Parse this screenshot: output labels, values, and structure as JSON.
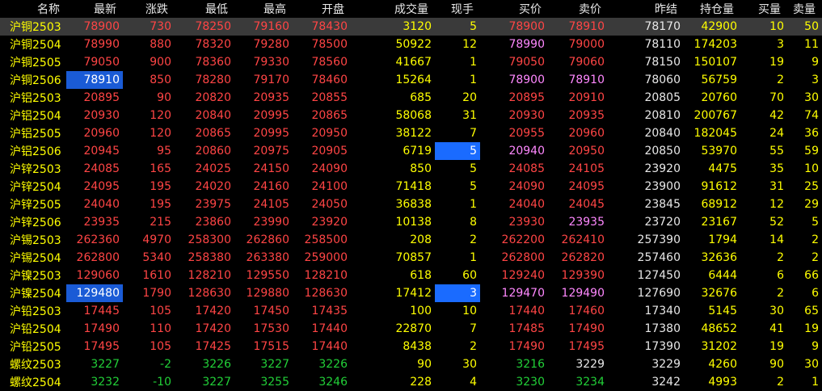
{
  "columns": [
    "名称",
    "最新",
    "涨跌",
    "最低",
    "最高",
    "开盘",
    "成交量",
    "现手",
    "买价",
    "卖价",
    "昨结",
    "持仓量",
    "买量",
    "卖量"
  ],
  "rows": [
    {
      "name": "沪铜2503",
      "last": "78900",
      "chg": "730",
      "low": "78250",
      "high": "79160",
      "open": "78430",
      "vol": "3120",
      "cur": "5",
      "bid": "78900",
      "ask": "78910",
      "prev": "78170",
      "oi": "42900",
      "bv": "10",
      "av": "50",
      "dir": "up",
      "bidc": "up",
      "askc": "up"
    },
    {
      "name": "沪铜2504",
      "last": "78990",
      "chg": "880",
      "low": "78320",
      "high": "79280",
      "open": "78500",
      "vol": "50922",
      "cur": "12",
      "bid": "78990",
      "ask": "79000",
      "prev": "78110",
      "oi": "174203",
      "bv": "3",
      "av": "11",
      "dir": "up",
      "bidc": "mag",
      "askc": "up"
    },
    {
      "name": "沪铜2505",
      "last": "79050",
      "chg": "900",
      "low": "78360",
      "high": "79330",
      "open": "78560",
      "vol": "41667",
      "cur": "1",
      "bid": "79050",
      "ask": "79060",
      "prev": "78150",
      "oi": "150107",
      "bv": "19",
      "av": "9",
      "dir": "up",
      "bidc": "up",
      "askc": "up"
    },
    {
      "name": "沪铜2506",
      "last": "78910",
      "chg": "850",
      "low": "78280",
      "high": "79170",
      "open": "78460",
      "vol": "15264",
      "cur": "1",
      "bid": "78900",
      "ask": "78910",
      "prev": "78060",
      "oi": "56759",
      "bv": "2",
      "av": "3",
      "dir": "up",
      "bidc": "mag",
      "askc": "mag"
    },
    {
      "name": "沪铝2503",
      "last": "20895",
      "chg": "90",
      "low": "20820",
      "high": "20935",
      "open": "20855",
      "vol": "685",
      "cur": "20",
      "bid": "20895",
      "ask": "20910",
      "prev": "20805",
      "oi": "20760",
      "bv": "70",
      "av": "30",
      "dir": "up",
      "bidc": "up",
      "askc": "up"
    },
    {
      "name": "沪铝2504",
      "last": "20930",
      "chg": "120",
      "low": "20840",
      "high": "20995",
      "open": "20865",
      "vol": "58068",
      "cur": "31",
      "bid": "20930",
      "ask": "20935",
      "prev": "20810",
      "oi": "200767",
      "bv": "42",
      "av": "74",
      "dir": "up",
      "bidc": "up",
      "askc": "up"
    },
    {
      "name": "沪铝2505",
      "last": "20960",
      "chg": "120",
      "low": "20865",
      "high": "20995",
      "open": "20950",
      "vol": "38122",
      "cur": "7",
      "bid": "20955",
      "ask": "20960",
      "prev": "20840",
      "oi": "182045",
      "bv": "24",
      "av": "36",
      "dir": "up",
      "bidc": "up",
      "askc": "up"
    },
    {
      "name": "沪铝2506",
      "last": "20945",
      "chg": "95",
      "low": "20860",
      "high": "20975",
      "open": "20905",
      "vol": "6719",
      "cur": "5",
      "bid": "20940",
      "ask": "20950",
      "prev": "20850",
      "oi": "53970",
      "bv": "55",
      "av": "59",
      "dir": "up",
      "bidc": "mag",
      "askc": "up"
    },
    {
      "name": "沪锌2503",
      "last": "24085",
      "chg": "165",
      "low": "24025",
      "high": "24150",
      "open": "24090",
      "vol": "850",
      "cur": "5",
      "bid": "24085",
      "ask": "24105",
      "prev": "23920",
      "oi": "4475",
      "bv": "35",
      "av": "10",
      "dir": "up",
      "bidc": "up",
      "askc": "up"
    },
    {
      "name": "沪锌2504",
      "last": "24095",
      "chg": "195",
      "low": "24020",
      "high": "24160",
      "open": "24100",
      "vol": "71418",
      "cur": "5",
      "bid": "24090",
      "ask": "24095",
      "prev": "23900",
      "oi": "91612",
      "bv": "31",
      "av": "25",
      "dir": "up",
      "bidc": "up",
      "askc": "up"
    },
    {
      "name": "沪锌2505",
      "last": "24040",
      "chg": "195",
      "low": "23975",
      "high": "24105",
      "open": "24050",
      "vol": "36838",
      "cur": "1",
      "bid": "24040",
      "ask": "24045",
      "prev": "23845",
      "oi": "68912",
      "bv": "12",
      "av": "29",
      "dir": "up",
      "bidc": "up",
      "askc": "up"
    },
    {
      "name": "沪锌2506",
      "last": "23935",
      "chg": "215",
      "low": "23860",
      "high": "23990",
      "open": "23920",
      "vol": "10138",
      "cur": "8",
      "bid": "23930",
      "ask": "23935",
      "prev": "23720",
      "oi": "23167",
      "bv": "52",
      "av": "5",
      "dir": "up",
      "bidc": "up",
      "askc": "mag"
    },
    {
      "name": "沪锡2503",
      "last": "262360",
      "chg": "4970",
      "low": "258300",
      "high": "262860",
      "open": "258500",
      "vol": "208",
      "cur": "2",
      "bid": "262200",
      "ask": "262410",
      "prev": "257390",
      "oi": "1794",
      "bv": "14",
      "av": "2",
      "dir": "up",
      "bidc": "up",
      "askc": "up"
    },
    {
      "name": "沪锡2504",
      "last": "262800",
      "chg": "5340",
      "low": "258380",
      "high": "263380",
      "open": "259000",
      "vol": "70857",
      "cur": "1",
      "bid": "262800",
      "ask": "262820",
      "prev": "257460",
      "oi": "32636",
      "bv": "2",
      "av": "2",
      "dir": "up",
      "bidc": "up",
      "askc": "up"
    },
    {
      "name": "沪镍2503",
      "last": "129060",
      "chg": "1610",
      "low": "128210",
      "high": "129550",
      "open": "128210",
      "vol": "618",
      "cur": "60",
      "bid": "129240",
      "ask": "129390",
      "prev": "127450",
      "oi": "6444",
      "bv": "6",
      "av": "66",
      "dir": "up",
      "bidc": "up",
      "askc": "up"
    },
    {
      "name": "沪镍2504",
      "last": "129480",
      "chg": "1790",
      "low": "128630",
      "high": "129880",
      "open": "128630",
      "vol": "17412",
      "cur": "3",
      "bid": "129470",
      "ask": "129490",
      "prev": "127690",
      "oi": "32676",
      "bv": "2",
      "av": "6",
      "dir": "up",
      "bidc": "mag",
      "askc": "mag"
    },
    {
      "name": "沪铅2503",
      "last": "17445",
      "chg": "105",
      "low": "17420",
      "high": "17450",
      "open": "17435",
      "vol": "100",
      "cur": "10",
      "bid": "17440",
      "ask": "17460",
      "prev": "17340",
      "oi": "5145",
      "bv": "30",
      "av": "65",
      "dir": "up",
      "bidc": "up",
      "askc": "up"
    },
    {
      "name": "沪铅2504",
      "last": "17490",
      "chg": "110",
      "low": "17420",
      "high": "17530",
      "open": "17440",
      "vol": "22870",
      "cur": "7",
      "bid": "17485",
      "ask": "17490",
      "prev": "17380",
      "oi": "48652",
      "bv": "41",
      "av": "19",
      "dir": "up",
      "bidc": "up",
      "askc": "up"
    },
    {
      "name": "沪铅2505",
      "last": "17495",
      "chg": "105",
      "low": "17425",
      "high": "17515",
      "open": "17440",
      "vol": "8438",
      "cur": "2",
      "bid": "17490",
      "ask": "17495",
      "prev": "17390",
      "oi": "31202",
      "bv": "19",
      "av": "9",
      "dir": "up",
      "bidc": "up",
      "askc": "up"
    },
    {
      "name": "螺纹2503",
      "last": "3227",
      "chg": "-2",
      "low": "3226",
      "high": "3227",
      "open": "3226",
      "vol": "90",
      "cur": "30",
      "bid": "3216",
      "ask": "3229",
      "prev": "3229",
      "oi": "4260",
      "bv": "90",
      "av": "30",
      "dir": "down",
      "bidc": "down",
      "askc": "flat"
    },
    {
      "name": "螺纹2504",
      "last": "3232",
      "chg": "-10",
      "low": "3227",
      "high": "3255",
      "open": "3246",
      "vol": "228",
      "cur": "4",
      "bid": "3230",
      "ask": "3234",
      "prev": "3242",
      "oi": "4993",
      "bv": "2",
      "av": "1",
      "dir": "down",
      "bidc": "down",
      "askc": "down"
    }
  ],
  "selected_row": 0,
  "highlight_last_rows": [
    3,
    15
  ],
  "highlight_cur_rows": [
    7,
    15
  ],
  "colors": {
    "up": "#ff4545",
    "down": "#22d038",
    "flat": "#e8e8e8",
    "yellow": "#ffff00",
    "magenta": "#ff88ff",
    "select": "#3a3a3a",
    "highlight": "#1a5bd6"
  }
}
